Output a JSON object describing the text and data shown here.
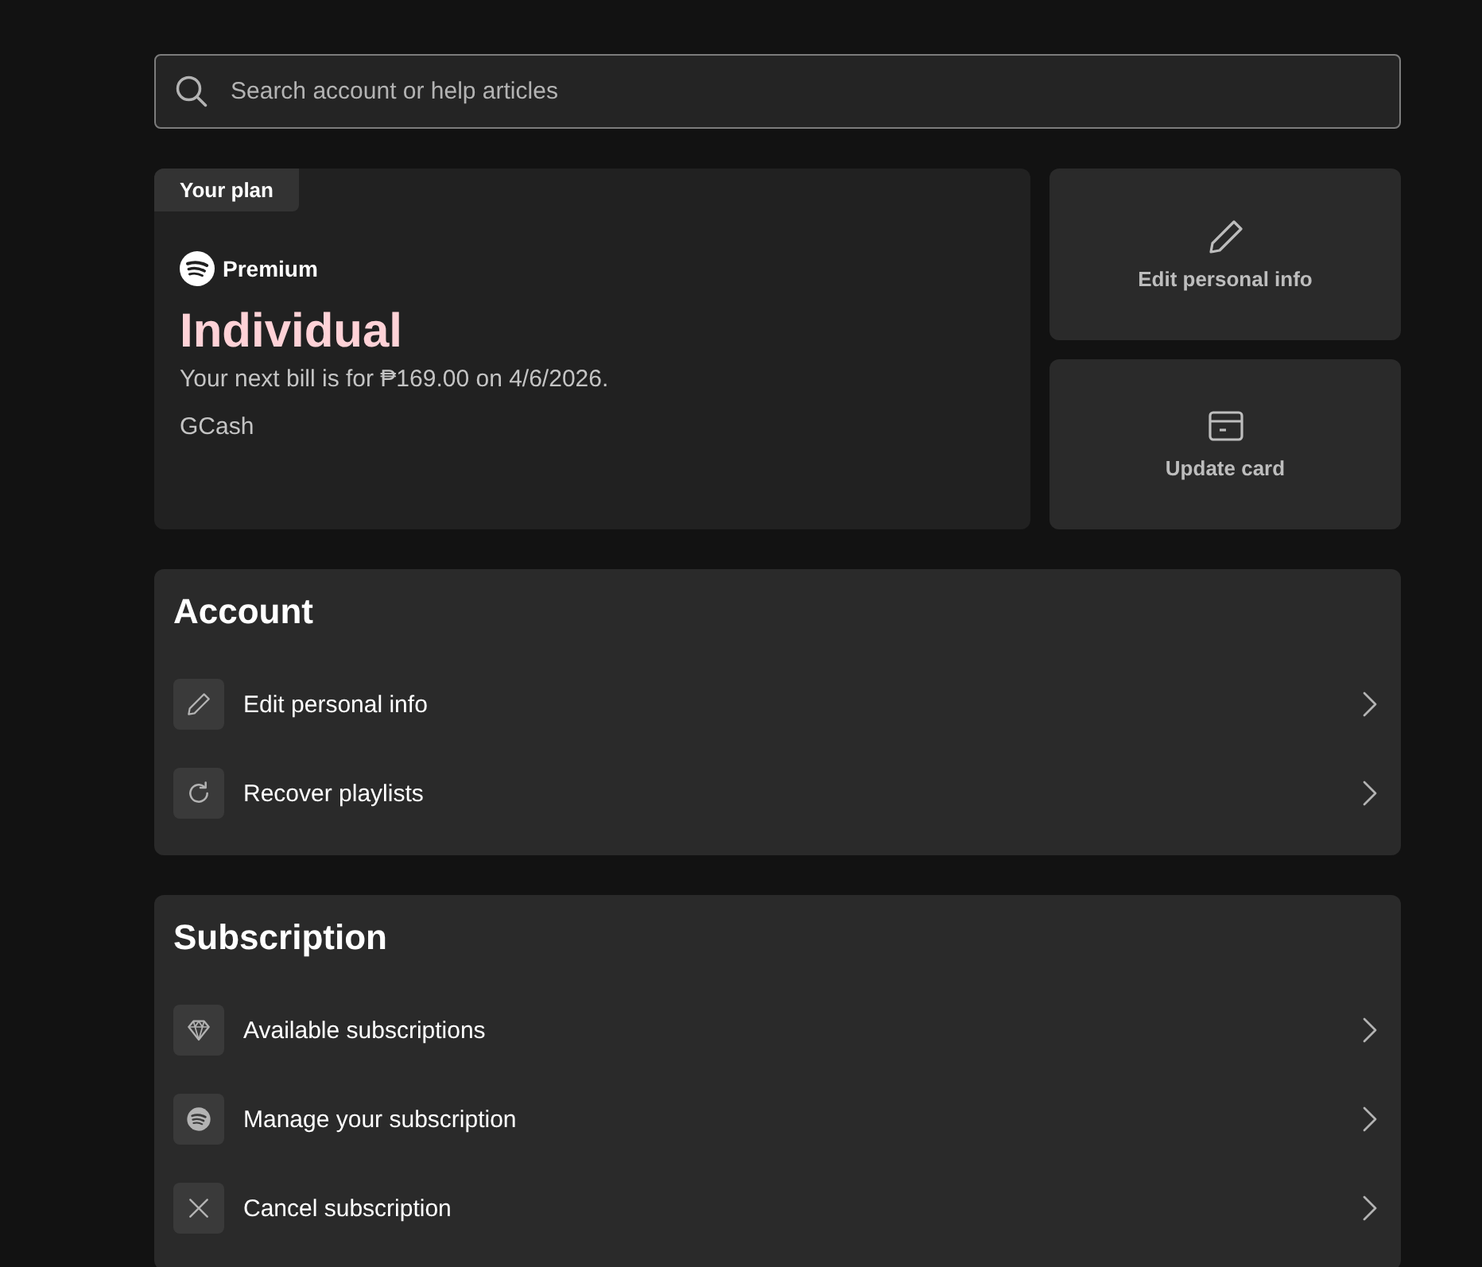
{
  "search": {
    "placeholder": "Search account or help articles"
  },
  "plan": {
    "badge": "Your plan",
    "tier": "Premium",
    "name": "Individual",
    "billing": "Your next bill is for ₱169.00 on 4/6/2026.",
    "payment_method": "GCash"
  },
  "quick_actions": [
    {
      "label": "Edit personal info"
    },
    {
      "label": "Update card"
    }
  ],
  "sections": [
    {
      "title": "Account",
      "items": [
        {
          "label": "Edit personal info"
        },
        {
          "label": "Recover playlists"
        }
      ]
    },
    {
      "title": "Subscription",
      "items": [
        {
          "label": "Available subscriptions"
        },
        {
          "label": "Manage your subscription"
        },
        {
          "label": "Cancel subscription"
        }
      ]
    }
  ]
}
